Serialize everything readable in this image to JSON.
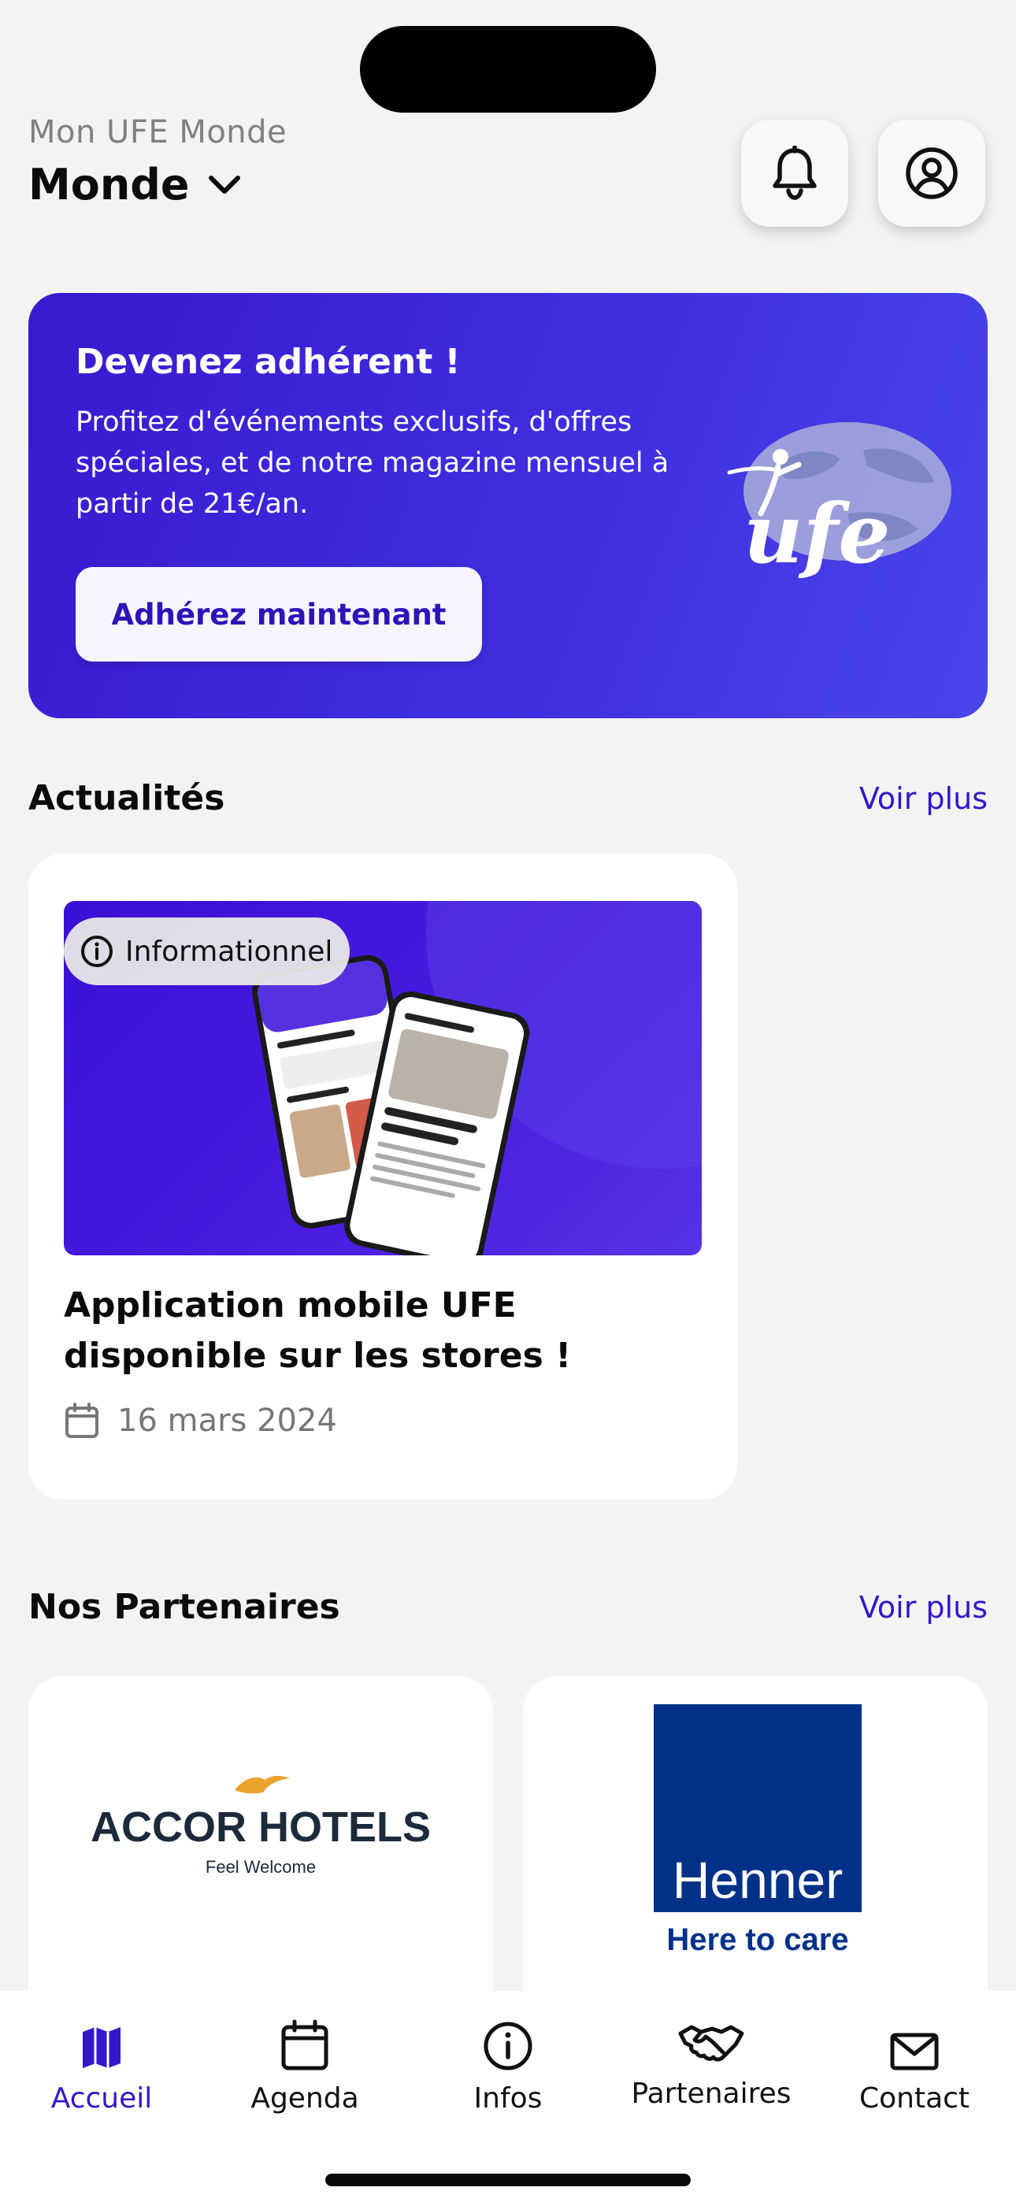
{
  "header": {
    "subtitle": "Mon UFE Monde",
    "title": "Monde",
    "notifications_icon": "bell-icon",
    "profile_icon": "user-circle-icon"
  },
  "banner": {
    "title": "Devenez adhérent !",
    "text": "Profitez d'événements exclusifs, d'offres spéciales, et de notre magazine mensuel à partir de 21€/an.",
    "button_label": "Adhérez maintenant",
    "logo_text": "ufe",
    "gradient_start": "#3a19cf",
    "gradient_end": "#4a45ea"
  },
  "news": {
    "section_title": "Actualités",
    "see_more": "Voir plus",
    "card": {
      "tag": "Informationnel",
      "title": "Application mobile UFE disponible sur les stores !",
      "date": "16 mars 2024"
    }
  },
  "partners": {
    "section_title": "Nos Partenaires",
    "see_more": "Voir plus",
    "items": [
      {
        "name": "ACCOR HOTELS",
        "tagline": "Feel Welcome"
      },
      {
        "name": "Henner",
        "tagline": "Here to care"
      }
    ]
  },
  "tabbar": {
    "items": [
      {
        "label": "Accueil",
        "icon": "map-icon",
        "active": true
      },
      {
        "label": "Agenda",
        "icon": "calendar-icon",
        "active": false
      },
      {
        "label": "Infos",
        "icon": "info-icon",
        "active": false
      },
      {
        "label": "Partenaires",
        "icon": "handshake-icon",
        "active": false
      },
      {
        "label": "Contact",
        "icon": "mail-icon",
        "active": false
      }
    ]
  },
  "colors": {
    "accent": "#3218c8",
    "background": "#f3f3f3",
    "henner_blue": "#003189",
    "accor_gold": "#e8a32a"
  }
}
